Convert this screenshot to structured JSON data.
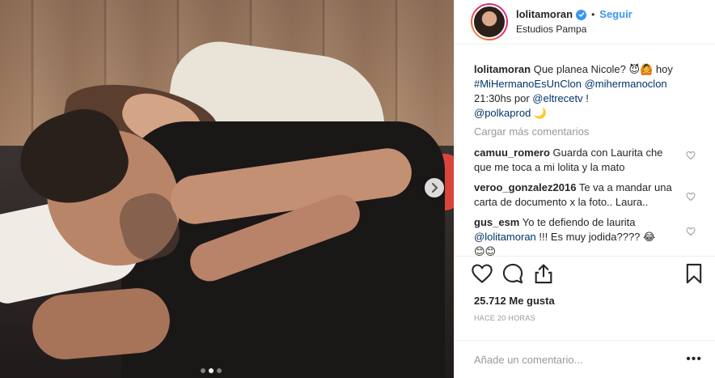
{
  "post": {
    "username": "lolitamoran",
    "follow_label": "Seguir",
    "separator": "•",
    "location": "Estudios Pampa",
    "verified": true
  },
  "caption": {
    "username": "lolitamoran",
    "text_1": "Que planea Nicole? ",
    "emoji_1": "😈🙆",
    "text_2": " hoy",
    "hashtag": "#MiHermanoEsUnClon",
    "mention_1": "@mihermanoclon",
    "text_3": "21:30hs por ",
    "mention_2": "@eltrecetv",
    "text_4": " !",
    "mention_3": "@polkaprod",
    "emoji_2": "🌙"
  },
  "load_more_label": "Cargar más comentarios",
  "comments": [
    {
      "username": "camuu_romero",
      "text": "Guarda con Laurita che que me toca a mi lolita y la mato"
    },
    {
      "username": "veroo_gonzalez2016",
      "text": "Te va a mandar una carta de documento x la foto.. Laura.."
    },
    {
      "username": "gus_esm",
      "text": "Yo te defiendo de laurita",
      "mention": "@lolitamoran",
      "text_2": " !!! Es muy jodida???? 😂",
      "text_3": "😊😊"
    }
  ],
  "likes_label": "25.712 Me gusta",
  "timestamp": "HACE 20 HORAS",
  "add_comment_placeholder": "Añade un comentario...",
  "more_label": "•••",
  "carousel": {
    "count": 3,
    "active_index": 1
  },
  "colors": {
    "link": "#003569",
    "follow": "#3897f0",
    "muted": "#999999"
  },
  "icons": {
    "like": "heart-icon",
    "comment": "comment-icon",
    "share": "share-icon",
    "save": "bookmark-icon",
    "next": "chevron-right-icon",
    "verified": "verified-badge-icon"
  }
}
